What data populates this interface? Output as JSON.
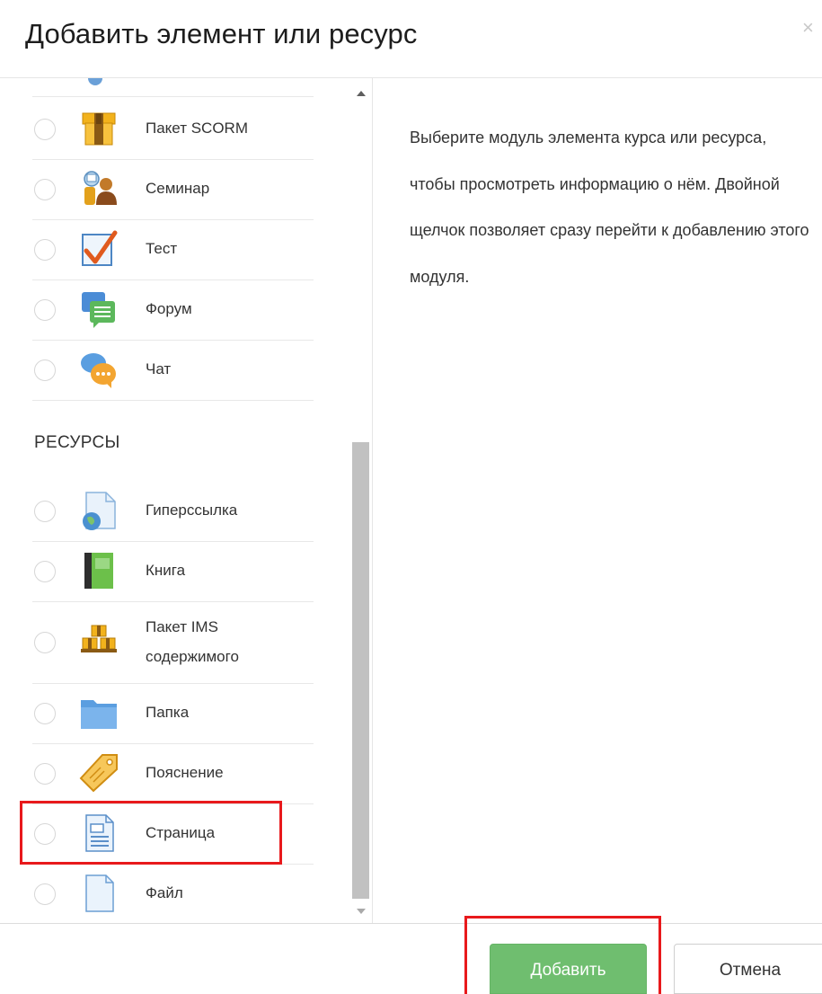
{
  "dialog": {
    "title": "Добавить элемент или ресурс",
    "close_symbol": "×"
  },
  "activities": [
    {
      "label": "Пакет SCORM",
      "icon": "scorm-package-icon"
    },
    {
      "label": "Семинар",
      "icon": "workshop-icon"
    },
    {
      "label": "Тест",
      "icon": "quiz-icon"
    },
    {
      "label": "Форум",
      "icon": "forum-icon"
    },
    {
      "label": "Чат",
      "icon": "chat-icon"
    }
  ],
  "resources_heading": "РЕСУРСЫ",
  "resources": [
    {
      "label": "Гиперссылка",
      "icon": "url-link-icon"
    },
    {
      "label": "Книга",
      "icon": "book-icon"
    },
    {
      "label_line1": "Пакет IMS",
      "label_line2": "содержимого",
      "icon": "ims-package-icon"
    },
    {
      "label": "Папка",
      "icon": "folder-icon"
    },
    {
      "label": "Пояснение",
      "icon": "label-tag-icon"
    },
    {
      "label": "Страница",
      "icon": "page-icon"
    },
    {
      "label": "Файл",
      "icon": "file-icon"
    }
  ],
  "help_text": "Выберите модуль элемента курса или ресурса, чтобы просмотреть информацию о нём. Двойной щелчок позволяет сразу перейти к добавлению этого модуля.",
  "footer": {
    "add_label": "Добавить",
    "cancel_label": "Отмена"
  },
  "colors": {
    "add_button": "#6fbe6f",
    "highlight_box": "#e8191c"
  }
}
